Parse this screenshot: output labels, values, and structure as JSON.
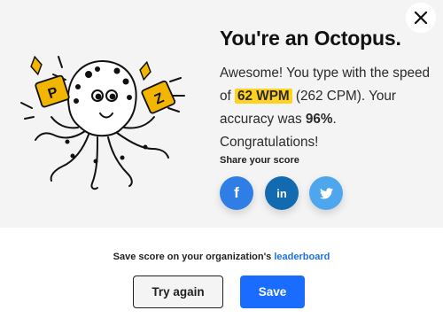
{
  "result": {
    "title": "You're an Octopus.",
    "line_prefix": "Awesome! You type with the speed of ",
    "wpm": "62 WPM",
    "line_mid": " (262 CPM). Your accuracy was ",
    "accuracy": "96%",
    "line_suffix": ". Congratulations!"
  },
  "share": {
    "label": "Share your score",
    "networks": [
      {
        "name": "facebook",
        "icon": "facebook-icon",
        "glyph": "f"
      },
      {
        "name": "linkedin",
        "icon": "linkedin-icon",
        "glyph": "in"
      },
      {
        "name": "twitter",
        "icon": "twitter-icon"
      }
    ]
  },
  "footer": {
    "save_note_prefix": "Save score on your organization's ",
    "leaderboard_link": "leaderboard",
    "try_again_label": "Try again",
    "save_label": "Save"
  },
  "illustration": {
    "tile_letters": [
      "P",
      "Z"
    ]
  },
  "colors": {
    "panel_bg": "#f4f4f4",
    "highlight": "#ffd21f",
    "primary": "#1a6cff",
    "link": "#1a73e8",
    "facebook": "#2f7ee6",
    "linkedin": "#126bb0",
    "twitter": "#4ea7ee"
  }
}
